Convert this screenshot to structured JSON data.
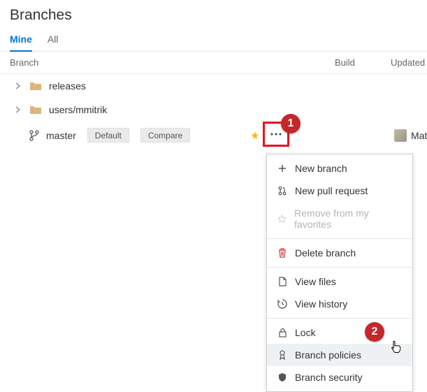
{
  "header": {
    "title": "Branches"
  },
  "tabs": {
    "mine": "Mine",
    "all": "All"
  },
  "columns": {
    "branch": "Branch",
    "build": "Build",
    "updated": "Updated"
  },
  "rows": {
    "releases": {
      "name": "releases"
    },
    "users": {
      "name": "users/mmitrik"
    },
    "master": {
      "name": "master",
      "tag_default": "Default",
      "tag_compare": "Compare",
      "user": "Matt"
    }
  },
  "menu": {
    "new_branch": "New branch",
    "new_pr": "New pull request",
    "remove_fav": "Remove from my favorites",
    "delete": "Delete branch",
    "view_files": "View files",
    "view_history": "View history",
    "lock": "Lock",
    "policies": "Branch policies",
    "security": "Branch security"
  },
  "callouts": {
    "one": "1",
    "two": "2"
  }
}
